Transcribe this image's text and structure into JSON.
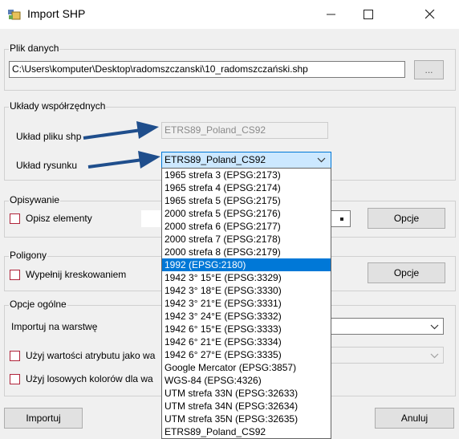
{
  "window": {
    "title": "Import SHP"
  },
  "data_file": {
    "group_label": "Plik danych",
    "path": "C:\\Users\\komputer\\Desktop\\radomszczanski\\10_radomszczański.shp",
    "browse_label": "..."
  },
  "coordinate_systems": {
    "group_label": "Układy współrzędnych",
    "shp_file_label": "Układ pliku shp",
    "shp_file_value": "ETRS89_Poland_CS92",
    "drawing_label": "Układ rysunku",
    "drawing_value": "ETRS89_Poland_CS92"
  },
  "describe": {
    "group_label": "Opisywanie",
    "describe_elements_label": "Opisz elementy",
    "options_label": "Opcje"
  },
  "polygons": {
    "group_label": "Poligony",
    "hatch_fill_label": "Wypełnij kreskowaniem",
    "options_label": "Opcje"
  },
  "general": {
    "group_label": "Opcje ogólne",
    "import_layer_label": "Importuj na warstwę",
    "use_attribute_label": "Użyj wartości atrybutu jako wa",
    "random_colors_label": "Użyj losowych kolorów dla wa"
  },
  "footer": {
    "import_label": "Importuj",
    "cancel_label": "Anuluj"
  },
  "dropdown": {
    "items": [
      "1965 strefa 3 (EPSG:2173)",
      "1965 strefa 4 (EPSG:2174)",
      "1965 strefa 5 (EPSG:2175)",
      "2000 strefa 5 (EPSG:2176)",
      "2000 strefa 6 (EPSG:2177)",
      "2000 strefa 7 (EPSG:2178)",
      "2000 strefa 8 (EPSG:2179)",
      "1992 (EPSG:2180)",
      "1942 3° 15°E (EPSG:3329)",
      "1942 3° 18°E (EPSG:3330)",
      "1942 3° 21°E (EPSG:3331)",
      "1942 3° 24°E (EPSG:3332)",
      "1942 6° 15°E (EPSG:3333)",
      "1942 6° 21°E (EPSG:3334)",
      "1942 6° 27°E (EPSG:3335)",
      "Google Mercator (EPSG:3857)",
      "WGS-84 (EPSG:4326)",
      "UTM strefa 33N (EPSG:32633)",
      "UTM strefa 34N (EPSG:32634)",
      "UTM strefa 35N (EPSG:32635)",
      "ETRS89_Poland_CS92"
    ],
    "selected": "1992 (EPSG:2180)"
  },
  "colors": {
    "selection": "#0078d7",
    "arrow": "#1f4e8c",
    "checkbox_border": "#b0243a",
    "combo_focus": "#cce8ff"
  }
}
